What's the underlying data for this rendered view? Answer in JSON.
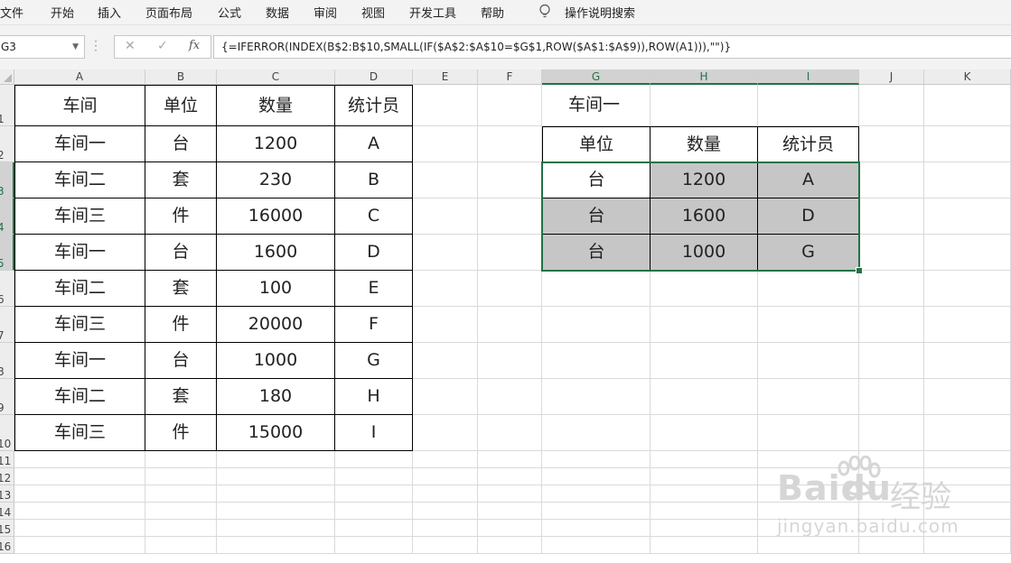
{
  "menu": {
    "items": [
      "文件",
      "开始",
      "插入",
      "页面布局",
      "公式",
      "数据",
      "审阅",
      "视图",
      "开发工具",
      "帮助"
    ],
    "search_label": "操作说明搜索"
  },
  "formula_bar": {
    "name_box": "G3",
    "cancel_glyph": "✕",
    "enter_glyph": "✓",
    "fx_glyph": "fx",
    "formula": "{=IFERROR(INDEX(B$2:B$10,SMALL(IF($A$2:$A$10=$G$1,ROW($A$1:$A$9)),ROW(A1))),\"\")}"
  },
  "columns": [
    "A",
    "B",
    "C",
    "D",
    "E",
    "F",
    "G",
    "H",
    "I",
    "J",
    "K"
  ],
  "rows": [
    "1",
    "2",
    "3",
    "4",
    "5",
    "6",
    "7",
    "8",
    "9",
    "10",
    "11",
    "12",
    "13",
    "14",
    "15",
    "16"
  ],
  "source_table": {
    "headers": [
      "车间",
      "单位",
      "数量",
      "统计员"
    ],
    "rows": [
      [
        "车间一",
        "台",
        "1200",
        "A"
      ],
      [
        "车间二",
        "套",
        "230",
        "B"
      ],
      [
        "车间三",
        "件",
        "16000",
        "C"
      ],
      [
        "车间一",
        "台",
        "1600",
        "D"
      ],
      [
        "车间二",
        "套",
        "100",
        "E"
      ],
      [
        "车间三",
        "件",
        "20000",
        "F"
      ],
      [
        "车间一",
        "台",
        "1000",
        "G"
      ],
      [
        "车间二",
        "套",
        "180",
        "H"
      ],
      [
        "车间三",
        "件",
        "15000",
        "I"
      ]
    ]
  },
  "result_table": {
    "criteria": "车间一",
    "headers": [
      "单位",
      "数量",
      "统计员"
    ],
    "rows": [
      [
        "台",
        "1200",
        "A"
      ],
      [
        "台",
        "1600",
        "D"
      ],
      [
        "台",
        "1000",
        "G"
      ]
    ]
  },
  "watermark": {
    "logo_text": "Baidu",
    "cn_text": "经验",
    "url": "jingyan.baidu.com"
  },
  "colors": {
    "selection": "#217346",
    "shade": "#c6c6c6"
  }
}
